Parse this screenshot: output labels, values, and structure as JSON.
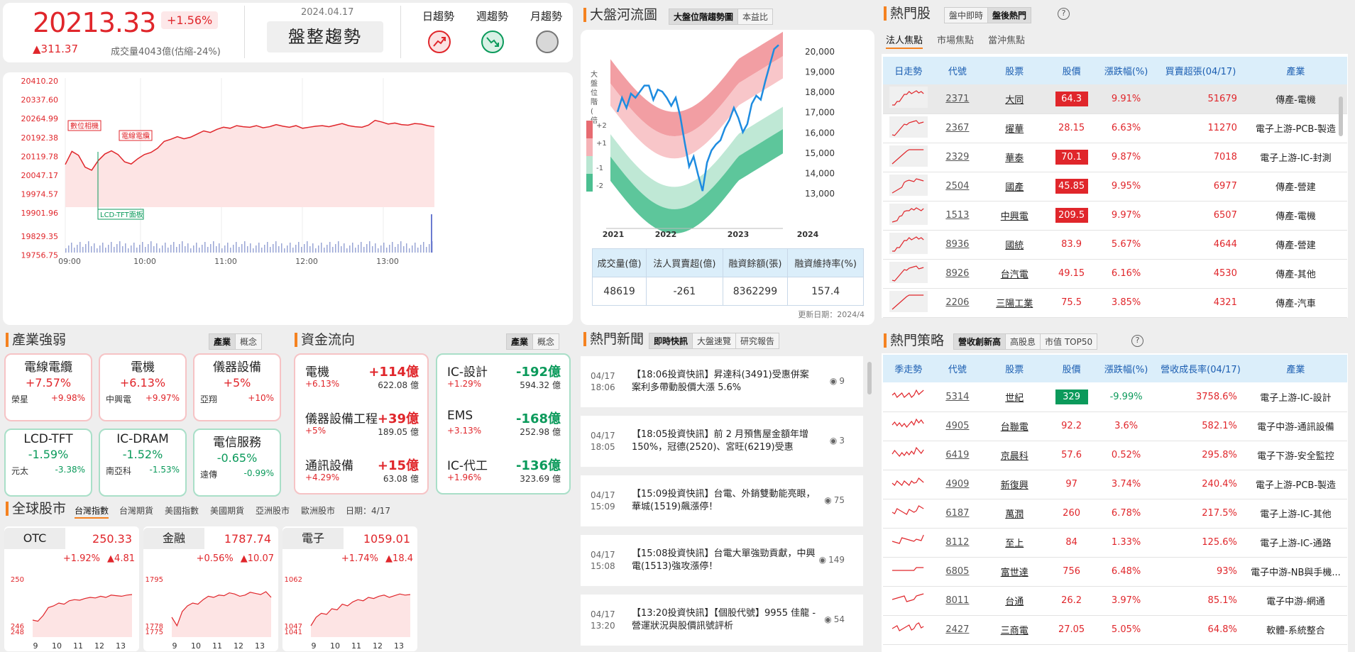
{
  "index": {
    "value": "20213.33",
    "change_pct": "+1.56%",
    "change": "▲311.37",
    "volume": "成交量4043億(估縮-24%)",
    "date": "2024.04.17",
    "trend_label": "盤整趨勢",
    "trends": [
      {
        "label": "日趨勢",
        "icon": "trend-up-icon",
        "color": "#e0262b"
      },
      {
        "label": "週趨勢",
        "icon": "trend-down-icon",
        "color": "#0b9a5b"
      },
      {
        "label": "月趨勢",
        "icon": "neutral-circle-icon",
        "color": "#b5b5b5"
      }
    ]
  },
  "intraday": {
    "y_ticks": [
      "20410.20",
      "20337.60",
      "20264.99",
      "20192.38",
      "20119.78",
      "20047.17",
      "19974.57",
      "19901.96",
      "19829.35",
      "19756.75"
    ],
    "x_ticks": [
      "09:00",
      "10:00",
      "11:00",
      "12:00",
      "13:00"
    ],
    "annotations": [
      "數位相機",
      "電線電纜",
      "LCD-TFT面板"
    ],
    "series": [
      20070,
      20120,
      20105,
      20060,
      20048,
      20085,
      20110,
      20122,
      20108,
      20080,
      20072,
      20092,
      20108,
      20116,
      20132,
      20158,
      20166,
      20176,
      20168,
      20174,
      20186,
      20198,
      20192,
      20204,
      20212,
      20208,
      20218,
      20214,
      20212,
      20218,
      20210,
      20214,
      20222,
      20216,
      20212,
      20218,
      20208,
      20212,
      20216,
      20218,
      20214,
      20220,
      20226,
      20218,
      20214,
      20212,
      20220,
      20238,
      20232,
      20224,
      20228,
      20222,
      20220,
      20226,
      20224,
      20218,
      20214
    ]
  },
  "river": {
    "title": "大盤河流圖",
    "tabs": [
      "大盤位階趨勢圖",
      "本益比"
    ],
    "active_tab": 0,
    "y_axis_label": "大盤位階(倍)",
    "legend": [
      "+2",
      "+1",
      "-1",
      "-2"
    ],
    "y_ticks": [
      "20,000",
      "19,000",
      "18,000",
      "17,000",
      "16,000",
      "15,000",
      "14,000",
      "13,000"
    ],
    "x_ticks": [
      "2021",
      "2022",
      "2023",
      "2024"
    ],
    "stats_headers": [
      "成交量(億)",
      "法人買賣超(億)",
      "融資餘額(張)",
      "融資維持率(%)"
    ],
    "stats_values": [
      "48619",
      "-261",
      "8362299",
      "157.4"
    ],
    "update": "更新日期：2024/4",
    "index_line": [
      17000,
      17700,
      17200,
      17900,
      17700,
      18000,
      18300,
      18300,
      17600,
      18100,
      18000,
      17700,
      17300,
      17700,
      16800,
      15500,
      14300,
      14800,
      13900,
      13100,
      14500,
      15100,
      15400,
      15600,
      16200,
      16600,
      17200,
      16700,
      16000,
      16400,
      17400,
      17800,
      17600,
      18500,
      19300,
      20100,
      20300
    ]
  },
  "hot_stocks": {
    "title": "熱門股",
    "tabs": [
      "盤中即時",
      "盤後熱門"
    ],
    "active_tab": 1,
    "sub_tabs": [
      "法人焦點",
      "市場焦點",
      "當沖焦點"
    ],
    "headers": [
      "日走勢",
      "代號",
      "股票",
      "股價",
      "漲跌幅(%)",
      "買賣超張(04/17)",
      "產業"
    ],
    "rows": [
      [
        "2371",
        "大同",
        "64.3",
        "9.91%",
        "51679",
        "傳產-電機"
      ],
      [
        "2367",
        "燿華",
        "28.15",
        "6.63%",
        "11270",
        "電子上游-PCB-製造"
      ],
      [
        "2329",
        "華泰",
        "70.1",
        "9.87%",
        "7018",
        "電子上游-IC-封測"
      ],
      [
        "2504",
        "國產",
        "45.85",
        "9.95%",
        "6977",
        "傳產-營建"
      ],
      [
        "1513",
        "中興電",
        "209.5",
        "9.97%",
        "6507",
        "傳產-電機"
      ],
      [
        "8936",
        "國統",
        "83.9",
        "5.67%",
        "4644",
        "傳產-營建"
      ],
      [
        "8926",
        "台汽電",
        "49.15",
        "6.16%",
        "4530",
        "傳產-其他"
      ],
      [
        "2206",
        "三陽工業",
        "75.5",
        "3.85%",
        "4321",
        "傳產-汽車"
      ]
    ],
    "boxed": [
      true,
      false,
      true,
      true,
      true,
      false,
      false,
      false
    ]
  },
  "strategy": {
    "title": "熱門策略",
    "tabs": [
      "營收創新高",
      "高股息",
      "市值 TOP50"
    ],
    "active_tab": 0,
    "headers": [
      "季走勢",
      "代號",
      "股票",
      "股價",
      "漲跌幅(%)",
      "營收成長率(04/17)",
      "產業"
    ],
    "rows": [
      [
        "5314",
        "世紀",
        "329",
        "-9.99%",
        "3758.6%",
        "電子上游-IC-設計"
      ],
      [
        "4905",
        "台聯電",
        "92.2",
        "3.6%",
        "582.1%",
        "電子中游-通訊設備"
      ],
      [
        "6419",
        "京晨科",
        "57.6",
        "0.52%",
        "295.8%",
        "電子下游-安全監控"
      ],
      [
        "4909",
        "新復興",
        "97",
        "3.74%",
        "240.4%",
        "電子上游-PCB-製造"
      ],
      [
        "6187",
        "萬潤",
        "260",
        "6.78%",
        "217.5%",
        "電子上游-IC-其他"
      ],
      [
        "8112",
        "至上",
        "84",
        "1.33%",
        "125.6%",
        "電子上游-IC-通路"
      ],
      [
        "6805",
        "富世達",
        "756",
        "6.48%",
        "93%",
        "電子中游-NB與手機..."
      ],
      [
        "8011",
        "台通",
        "26.2",
        "3.97%",
        "85.1%",
        "電子中游-網通"
      ],
      [
        "2427",
        "三商電",
        "27.05",
        "5.05%",
        "64.8%",
        "軟體-系統整合"
      ]
    ]
  },
  "industry": {
    "title": "產業強弱",
    "tabs": [
      "產業",
      "概念"
    ],
    "tiles": [
      {
        "name": "電線電纜",
        "pct": "+7.57%",
        "stock": "榮星",
        "spct": "+9.98%",
        "up": true
      },
      {
        "name": "電機",
        "pct": "+6.13%",
        "stock": "中興電",
        "spct": "+9.97%",
        "up": true
      },
      {
        "name": "儀器設備",
        "pct": "+5%",
        "stock": "亞翔",
        "spct": "+10%",
        "up": true
      },
      {
        "name": "LCD-TFT",
        "pct": "-1.59%",
        "stock": "元太",
        "spct": "-3.38%",
        "up": false
      },
      {
        "name": "IC-DRAM",
        "pct": "-1.52%",
        "stock": "南亞科",
        "spct": "-1.53%",
        "up": false
      },
      {
        "name": "電信服務",
        "pct": "-0.65%",
        "stock": "遠傳",
        "spct": "-0.99%",
        "up": false
      }
    ]
  },
  "fund": {
    "title": "資金流向",
    "tabs": [
      "產業",
      "概念"
    ],
    "in": [
      {
        "name": "電機",
        "value": "+114億",
        "pct": "+6.13%",
        "amt": "622.08 億"
      },
      {
        "name": "儀器設備工程",
        "value": "+39億",
        "pct": "+5%",
        "amt": "189.05 億"
      },
      {
        "name": "通訊設備",
        "value": "+15億",
        "pct": "+4.29%",
        "amt": "63.08 億"
      }
    ],
    "out": [
      {
        "name": "IC-設計",
        "value": "-192億",
        "pct": "+1.29%",
        "amt": "594.32 億"
      },
      {
        "name": "EMS",
        "value": "-168億",
        "pct": "+3.13%",
        "amt": "252.98 億"
      },
      {
        "name": "IC-代工",
        "value": "-136億",
        "pct": "+1.96%",
        "amt": "323.69 億"
      }
    ]
  },
  "news": {
    "title": "熱門新聞",
    "tabs": [
      "即時快訊",
      "大盤速覽",
      "研究報告"
    ],
    "items": [
      {
        "date": "04/17",
        "time": "18:06",
        "text": "【18:06投資快訊】昇達科(3491)受惠併案案利多帶動股價大漲 5.6%",
        "views": "9"
      },
      {
        "date": "04/17",
        "time": "18:05",
        "text": "【18:05投資快訊】前 2 月預售屋金額年增 150%，冠德(2520)、宮旺(6219)受惠",
        "views": "3"
      },
      {
        "date": "04/17",
        "time": "15:09",
        "text": "【15:09投資快訊】台電、外銷雙動能亮眼，華城(1519)飆漲停！",
        "views": "75"
      },
      {
        "date": "04/17",
        "time": "15:08",
        "text": "【15:08投資快訊】台電大單強勁貢獻，中興電(1513)強攻漲停！",
        "views": "149"
      },
      {
        "date": "04/17",
        "time": "13:20",
        "text": "【13:20投資快訊】【個股代號】9955 佳龍 - 營運狀況與股價訊號評析",
        "views": "54"
      }
    ]
  },
  "global": {
    "title": "全球股市",
    "tabs": [
      "台灣指數",
      "台灣期貨",
      "美國指數",
      "美國期貨",
      "亞洲股市",
      "歐洲股市"
    ],
    "date": "日期：4/17",
    "minis": [
      {
        "label": "OTC",
        "value": "250.33",
        "pct": "+1.92%",
        "chg": "▲4.81",
        "y_top": "250",
        "y_a": "246",
        "y_b": "248",
        "ticks": [
          "9",
          "10",
          "11",
          "12",
          "13"
        ],
        "series": [
          0.3,
          0.28,
          0.38,
          0.52,
          0.55,
          0.6,
          0.58,
          0.64,
          0.66,
          0.65,
          0.68,
          0.7,
          0.69,
          0.72,
          0.7,
          0.74,
          0.73,
          0.72,
          0.74,
          0.75
        ]
      },
      {
        "label": "金融",
        "value": "1787.74",
        "pct": "+0.56%",
        "chg": "▲10.07",
        "y_top": "1795",
        "y_a": "1778",
        "y_b": "1775",
        "ticks": [
          "9",
          "10",
          "11",
          "12",
          "13"
        ],
        "series": [
          0.35,
          0.2,
          0.45,
          0.55,
          0.6,
          0.58,
          0.66,
          0.72,
          0.7,
          0.74,
          0.73,
          0.78,
          0.76,
          0.72,
          0.74,
          0.79,
          0.77,
          0.75,
          0.8,
          0.7
        ]
      },
      {
        "label": "電子",
        "value": "1059.01",
        "pct": "+1.74%",
        "chg": "▲18.4",
        "y_top": "1062",
        "y_a": "1047",
        "y_b": "1041",
        "ticks": [
          "9",
          "10",
          "11",
          "12",
          "13"
        ],
        "series": [
          0.2,
          0.35,
          0.42,
          0.4,
          0.5,
          0.48,
          0.58,
          0.55,
          0.62,
          0.66,
          0.64,
          0.7,
          0.68,
          0.72,
          0.74,
          0.7,
          0.73,
          0.76,
          0.74,
          0.75
        ]
      }
    ]
  }
}
